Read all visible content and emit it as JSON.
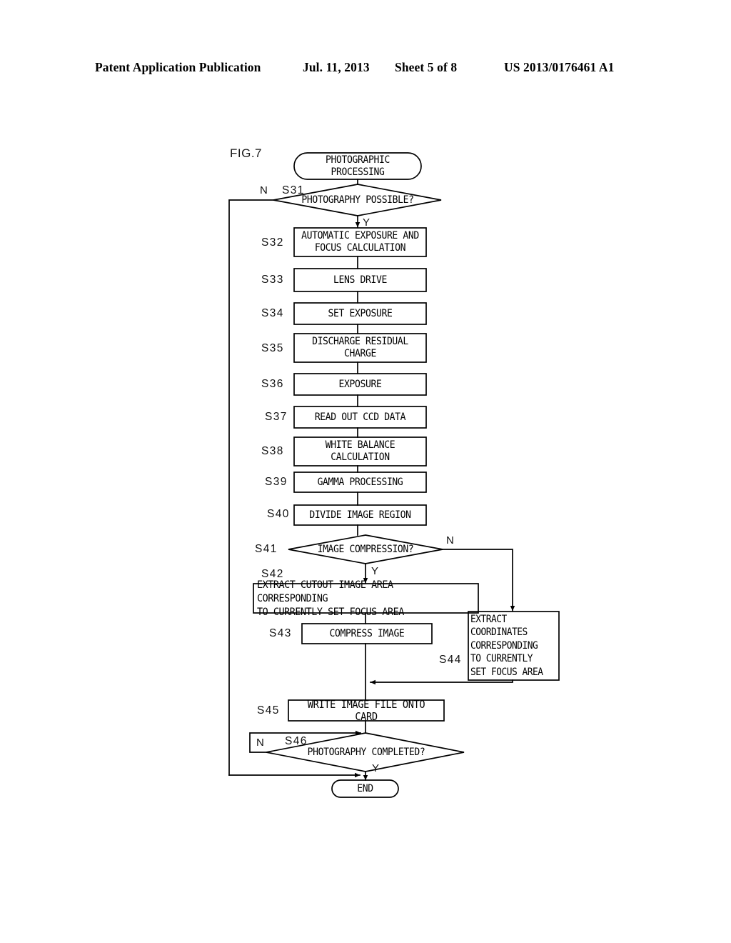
{
  "header": {
    "publication": "Patent Application Publication",
    "date": "Jul. 11, 2013",
    "sheet": "Sheet 5 of 8",
    "number": "US 2013/0176461 A1"
  },
  "figure": {
    "label": "FIG.7",
    "start_terminal": "PHOTOGRAPHIC\nPROCESSING",
    "end_terminal": "END"
  },
  "steps": [
    {
      "id": "S31",
      "label": "S31",
      "type": "decision",
      "text": "PHOTOGRAPHY POSSIBLE?"
    },
    {
      "id": "S32",
      "label": "S32",
      "type": "process",
      "text": "AUTOMATIC EXPOSURE AND\nFOCUS CALCULATION"
    },
    {
      "id": "S33",
      "label": "S33",
      "type": "process",
      "text": "LENS DRIVE"
    },
    {
      "id": "S34",
      "label": "S34",
      "type": "process",
      "text": "SET EXPOSURE"
    },
    {
      "id": "S35",
      "label": "S35",
      "type": "process",
      "text": "DISCHARGE RESIDUAL\nCHARGE"
    },
    {
      "id": "S36",
      "label": "S36",
      "type": "process",
      "text": "EXPOSURE"
    },
    {
      "id": "S37",
      "label": "S37",
      "type": "process",
      "text": "READ OUT CCD DATA"
    },
    {
      "id": "S38",
      "label": "S38",
      "type": "process",
      "text": "WHITE BALANCE\nCALCULATION"
    },
    {
      "id": "S39",
      "label": "S39",
      "type": "process",
      "text": "GAMMA PROCESSING"
    },
    {
      "id": "S40",
      "label": "S40",
      "type": "process",
      "text": "DIVIDE IMAGE REGION"
    },
    {
      "id": "S41",
      "label": "S41",
      "type": "decision",
      "text": "IMAGE COMPRESSION?"
    },
    {
      "id": "S42",
      "label": "S42",
      "type": "process",
      "text": "EXTRACT CUTOUT IMAGE AREA CORRESPONDING\nTO CURRENTLY SET FOCUS AREA"
    },
    {
      "id": "S43",
      "label": "S43",
      "type": "process",
      "text": "COMPRESS IMAGE"
    },
    {
      "id": "S44",
      "label": "S44",
      "type": "process",
      "text": "EXTRACT\nCOORDINATES\nCORRESPONDING\nTO CURRENTLY\nSET FOCUS AREA"
    },
    {
      "id": "S45",
      "label": "S45",
      "type": "process",
      "text": "WRITE IMAGE FILE ONTO CARD"
    },
    {
      "id": "S46",
      "label": "S46",
      "type": "decision",
      "text": "PHOTOGRAPHY COMPLETED?"
    }
  ],
  "branches": {
    "s31_no": "N",
    "s31_yes": "Y",
    "s41_no": "N",
    "s41_yes": "Y",
    "s46_no": "N",
    "s46_yes": "Y"
  },
  "colors": {
    "ink": "#000000",
    "paper": "#ffffff"
  }
}
